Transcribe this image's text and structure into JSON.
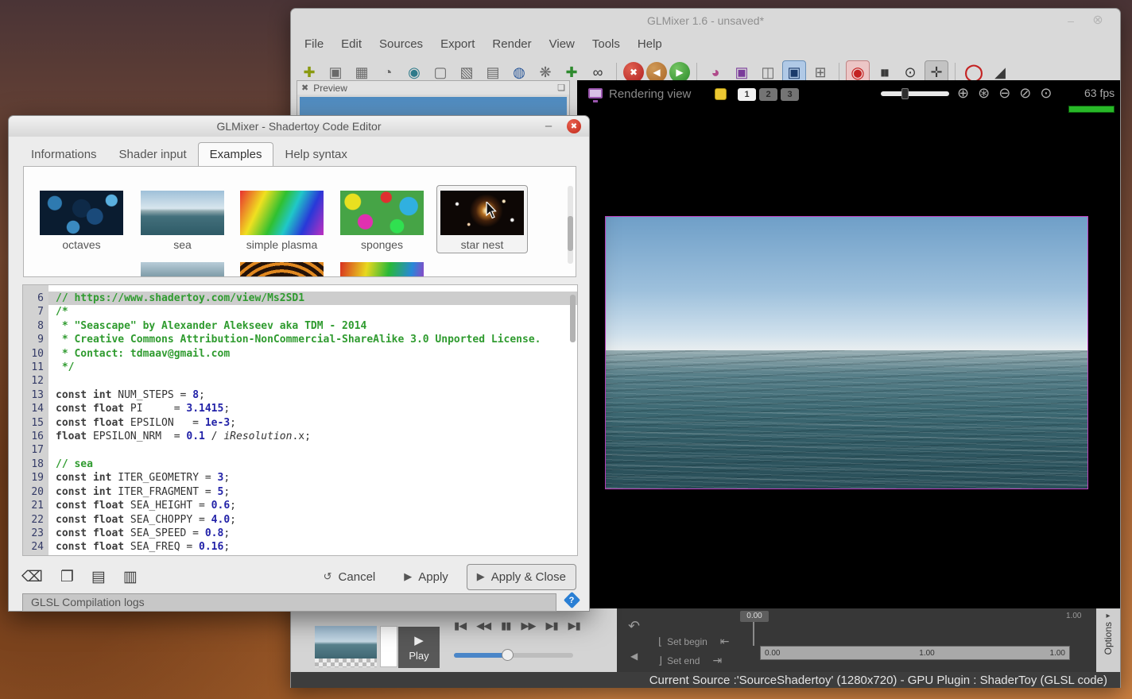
{
  "colors": {
    "render_border": "#c040c0",
    "selection_blue": "#4a86c8",
    "record_red": "#c42222",
    "meter_green": "#28b828",
    "help_blue": "#2a7fd4"
  },
  "icons": {
    "minimize": "–",
    "close": "⊗",
    "dialog_minimize": "–",
    "dialog_close": "✖",
    "preview_close": "✖",
    "detach": "❏",
    "play": "▶",
    "undo": "↶",
    "collapse_left": "◀",
    "set_begin_mark": "⌊",
    "set_end_mark": "⌋",
    "goto_begin": "⇤",
    "goto_end": "⇥",
    "options_arrow": "▸",
    "cancel": "↺",
    "apply": "▶",
    "help": "?"
  },
  "main_window": {
    "title": "GLMixer 1.6 - unsaved*",
    "menu": [
      "File",
      "Edit",
      "Sources",
      "Export",
      "Render",
      "View",
      "Tools",
      "Help"
    ],
    "toolbar": [
      {
        "name": "new-session-icon",
        "glyph": "✚",
        "color": "#8a9a10"
      },
      {
        "name": "open-session-icon",
        "glyph": "▣",
        "color": "#6a6a6a"
      },
      {
        "name": "save-session-icon",
        "glyph": "▦",
        "color": "#6a6a6a"
      },
      {
        "name": "session-switcher-icon",
        "glyph": "◔",
        "color": "#6a6a6a"
      },
      {
        "name": "new-device-source-icon",
        "glyph": "◉",
        "color": "#2e7a8a"
      },
      {
        "name": "new-render-source-icon",
        "glyph": "▢",
        "color": "#6a6a6a"
      },
      {
        "name": "new-capture-source-icon",
        "glyph": "▧",
        "color": "#6a6a6a"
      },
      {
        "name": "new-clipboard-source-icon",
        "glyph": "▤",
        "color": "#6a6a6a"
      },
      {
        "name": "new-network-source-icon",
        "glyph": "◍",
        "color": "#2e5a9a"
      },
      {
        "name": "new-algorithm-source-icon",
        "glyph": "❋",
        "color": "#6a6a6a"
      },
      {
        "name": "new-svg-source-icon",
        "glyph": "✚",
        "color": "#2e8a2e"
      },
      {
        "name": "clone-source-icon",
        "glyph": "∞",
        "color": "#3a3a3a"
      },
      {
        "sep": true
      },
      {
        "name": "delete-source-icon",
        "glyph": "✖",
        "cls": "circ red"
      },
      {
        "name": "previous-source-icon",
        "glyph": "◀",
        "cls": "circ orange"
      },
      {
        "name": "next-source-icon",
        "glyph": "▶",
        "cls": "circ green"
      },
      {
        "sep": true
      },
      {
        "name": "mixing-view-icon",
        "glyph": "◕",
        "color": "#b04a8a"
      },
      {
        "name": "geometry-view-icon",
        "glyph": "▣",
        "color": "#7a3a9a"
      },
      {
        "name": "layers-view-icon",
        "glyph": "◫",
        "color": "#6a6a6a"
      },
      {
        "name": "rendering-view-icon",
        "glyph": "▣",
        "color": "#1a3a6a",
        "cls": "active-blue"
      },
      {
        "name": "mosaic-view-icon",
        "glyph": "⊞",
        "color": "#6a6a6a"
      },
      {
        "sep": true
      },
      {
        "name": "render-disable-icon",
        "glyph": "◉",
        "cls": "active-red",
        "color": "#c42222"
      },
      {
        "name": "render-pause-icon",
        "glyph": "▮▮",
        "color": "#3a3a3a",
        "cls": "pair"
      },
      {
        "name": "zoom-tool-icon",
        "glyph": "⊙",
        "color": "#3a3a3a"
      },
      {
        "name": "grab-tool-icon",
        "glyph": "✛",
        "color": "#3a3a3a",
        "cls": "pressed"
      },
      {
        "sep": true
      },
      {
        "name": "record-icon",
        "glyph": "◯",
        "color": "#c42222",
        "cls": "ring"
      },
      {
        "name": "record-continue-icon",
        "glyph": "◢",
        "color": "#3a3a3a"
      }
    ],
    "preview": {
      "title": "Preview"
    },
    "rendering": {
      "label": "Rendering view",
      "layers": [
        "1",
        "2",
        "3"
      ],
      "fps": "63 fps",
      "zoom_icons": [
        {
          "name": "zoom-in-icon",
          "glyph": "⊕"
        },
        {
          "name": "zoom-fit-icon",
          "glyph": "⊛"
        },
        {
          "name": "zoom-out-icon",
          "glyph": "⊖"
        },
        {
          "name": "zoom-reset-icon",
          "glyph": "⊘"
        },
        {
          "name": "zoom-current-icon",
          "glyph": "⊙"
        }
      ]
    },
    "transport": {
      "play_label": "Play",
      "media_icons": [
        {
          "name": "skip-backward-icon",
          "glyph": "▮◀"
        },
        {
          "name": "rewind-icon",
          "glyph": "◀◀"
        },
        {
          "name": "pause-icon",
          "glyph": "▮▮"
        },
        {
          "name": "fast-forward-icon",
          "glyph": "▶▶"
        },
        {
          "name": "skip-forward-icon",
          "glyph": "▶▮"
        },
        {
          "name": "play-to-end-icon",
          "glyph": "▶▮"
        }
      ],
      "set_begin": "Set begin",
      "set_end": "Set end",
      "marker_value": "0.00",
      "range_end_value": "1.00",
      "track_begin": "0.00",
      "track_speed": "1.00",
      "track_end": "1.00",
      "options_label": "Options"
    },
    "status": "Current Source :'SourceShadertoy' (1280x720) - GPU Plugin : ShaderToy (GLSL code)"
  },
  "dialog": {
    "title": "GLMixer - Shadertoy Code Editor",
    "tabs": [
      "Informations",
      "Shader input",
      "Examples",
      "Help syntax"
    ],
    "active_tab": "Examples",
    "selected_example": 4,
    "examples": [
      {
        "label": "octaves",
        "kind": "octaves"
      },
      {
        "label": "sea",
        "kind": "sea"
      },
      {
        "label": "simple plasma",
        "kind": "plasma"
      },
      {
        "label": "sponges",
        "kind": "sponges"
      },
      {
        "label": "star nest",
        "kind": "starnest"
      }
    ],
    "examples_row2": [
      {
        "kind": "sea2"
      },
      {
        "kind": "lattice"
      },
      {
        "kind": "rainbow"
      }
    ],
    "code": {
      "lines": [
        {
          "n": 6,
          "h": true,
          "t": [
            [
              "c",
              "// https://www.shadertoy.com/view/Ms2SD1"
            ]
          ]
        },
        {
          "n": 7,
          "t": [
            [
              "c",
              "/*"
            ]
          ]
        },
        {
          "n": 8,
          "t": [
            [
              "c",
              " * \"Seascape\" by Alexander Alekseev aka TDM - 2014"
            ]
          ]
        },
        {
          "n": 9,
          "t": [
            [
              "c",
              " * Creative Commons Attribution-NonCommercial-ShareAlike 3.0 Unported License."
            ]
          ]
        },
        {
          "n": 10,
          "t": [
            [
              "c",
              " * Contact: tdmaav@gmail.com"
            ]
          ]
        },
        {
          "n": 11,
          "t": [
            [
              "c",
              " */"
            ]
          ]
        },
        {
          "n": 12,
          "t": []
        },
        {
          "n": 13,
          "t": [
            [
              "k",
              "const int"
            ],
            [
              "p",
              " NUM_STEPS = "
            ],
            [
              "n",
              "8"
            ],
            [
              "p",
              ";"
            ]
          ]
        },
        {
          "n": 14,
          "t": [
            [
              "k",
              "const float"
            ],
            [
              "p",
              " PI     = "
            ],
            [
              "n",
              "3.1415"
            ],
            [
              "p",
              ";"
            ]
          ]
        },
        {
          "n": 15,
          "t": [
            [
              "k",
              "const float"
            ],
            [
              "p",
              " EPSILON   = "
            ],
            [
              "n",
              "1e-3"
            ],
            [
              "p",
              ";"
            ]
          ]
        },
        {
          "n": 16,
          "t": [
            [
              "k",
              "float"
            ],
            [
              "p",
              " EPSILON_NRM  = "
            ],
            [
              "n",
              "0.1"
            ],
            [
              "p",
              " / "
            ],
            [
              "b",
              "iResolution"
            ],
            [
              "p",
              ".x;"
            ]
          ]
        },
        {
          "n": 17,
          "t": []
        },
        {
          "n": 18,
          "t": [
            [
              "c",
              "// sea"
            ]
          ]
        },
        {
          "n": 19,
          "t": [
            [
              "k",
              "const int"
            ],
            [
              "p",
              " ITER_GEOMETRY = "
            ],
            [
              "n",
              "3"
            ],
            [
              "p",
              ";"
            ]
          ]
        },
        {
          "n": 20,
          "t": [
            [
              "k",
              "const int"
            ],
            [
              "p",
              " ITER_FRAGMENT = "
            ],
            [
              "n",
              "5"
            ],
            [
              "p",
              ";"
            ]
          ]
        },
        {
          "n": 21,
          "t": [
            [
              "k",
              "const float"
            ],
            [
              "p",
              " SEA_HEIGHT = "
            ],
            [
              "n",
              "0.6"
            ],
            [
              "p",
              ";"
            ]
          ]
        },
        {
          "n": 22,
          "t": [
            [
              "k",
              "const float"
            ],
            [
              "p",
              " SEA_CHOPPY = "
            ],
            [
              "n",
              "4.0"
            ],
            [
              "p",
              ";"
            ]
          ]
        },
        {
          "n": 23,
          "t": [
            [
              "k",
              "const float"
            ],
            [
              "p",
              " SEA_SPEED = "
            ],
            [
              "n",
              "0.8"
            ],
            [
              "p",
              ";"
            ]
          ]
        },
        {
          "n": 24,
          "t": [
            [
              "k",
              "const float"
            ],
            [
              "p",
              " SEA_FREQ = "
            ],
            [
              "n",
              "0.16"
            ],
            [
              "p",
              ";"
            ]
          ]
        }
      ]
    },
    "tool_icons": [
      {
        "name": "clear-code-icon",
        "glyph": "⌫"
      },
      {
        "name": "duplicate-code-icon",
        "glyph": "❐"
      },
      {
        "name": "paste-code-icon",
        "glyph": "▤"
      },
      {
        "name": "insert-template-icon",
        "glyph": "▥"
      }
    ],
    "buttons": {
      "cancel": "Cancel",
      "apply": "Apply",
      "apply_close": "Apply & Close"
    },
    "logs_label": "GLSL Compilation logs"
  }
}
